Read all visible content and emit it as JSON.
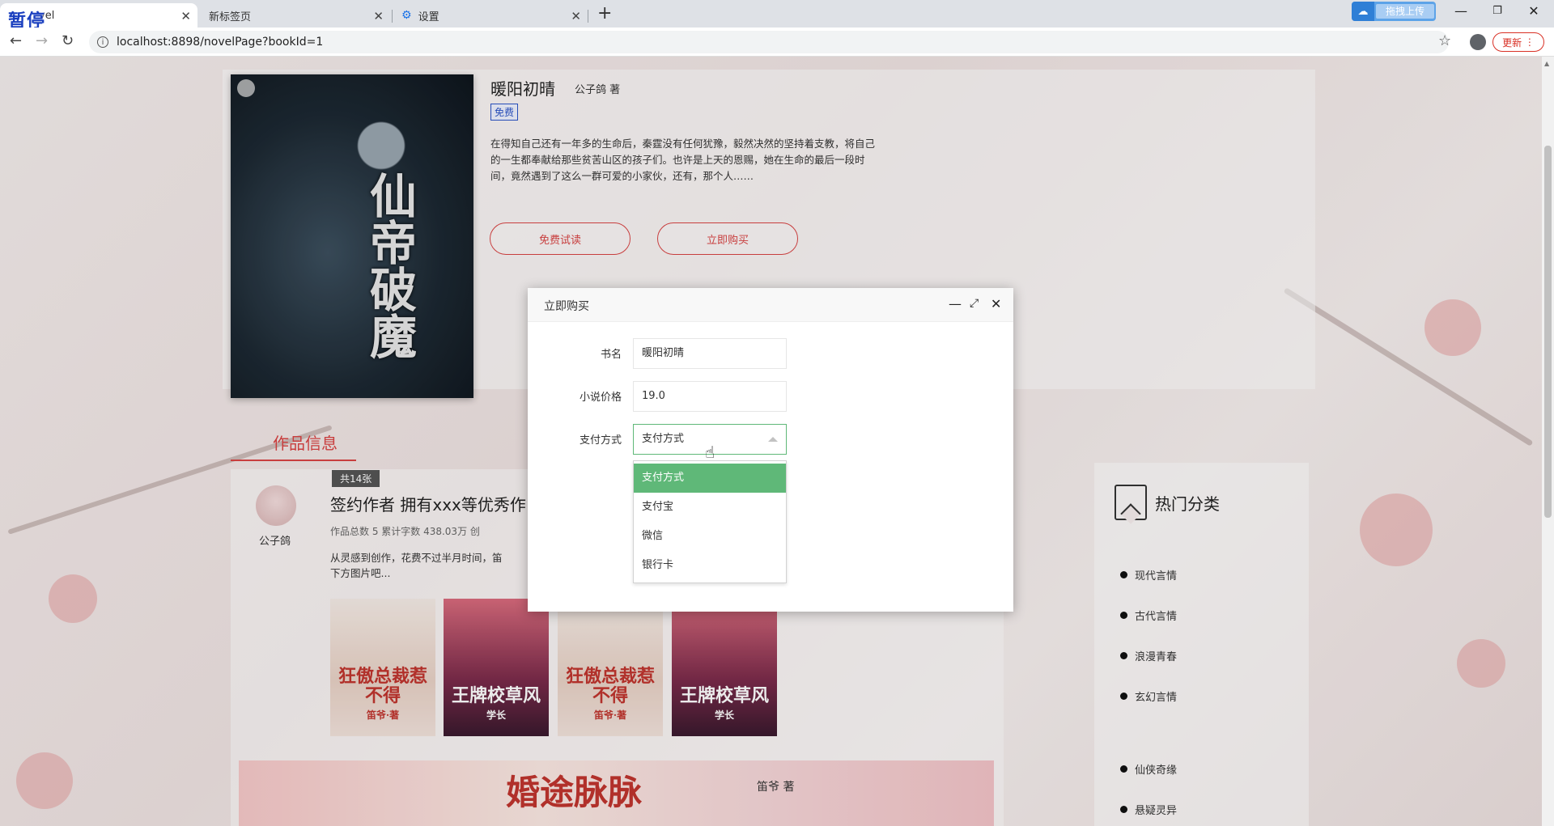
{
  "browser": {
    "tabs": [
      {
        "label": "vel",
        "active": true
      },
      {
        "label": "新标签页",
        "active": false
      },
      {
        "label": "设置",
        "active": false
      }
    ],
    "pause_overlay": "暂停",
    "upload_label": "拖拽上传",
    "url": "localhost:8898/novelPage?bookId=1",
    "update_label": "更新"
  },
  "book": {
    "title": "暖阳初晴",
    "author": "公子鸽 著",
    "badge": "免费",
    "cover_title": "仙帝破魔",
    "description": "在得知自己还有一年多的生命后，秦霆没有任何犹豫，毅然决然的坚持着支教，将自己的一生都奉献给那些贫苦山区的孩子们。也许是上天的恩赐，她在生命的最后一段时间，竟然遇到了这么一群可爱的小家伙，还有，那个人……",
    "free_read_label": "免费试读",
    "buy_label": "立即购买"
  },
  "works": {
    "tab_label": "作品信息",
    "count_tag": "共14张",
    "author_name": "公子鸽",
    "headline": "签约作者 拥有xxx等优秀作",
    "stats": "作品总数 5    累计字数 438.03万    创",
    "description": "从灵感到创作，花费不过半月时间，笛",
    "description2": "下方图片吧...",
    "thumbs": [
      {
        "title": "狂傲总裁惹不得",
        "author": "笛爷·著"
      },
      {
        "title": "王牌校草风",
        "author": "学长"
      },
      {
        "title": "狂傲总裁惹不得",
        "author": "笛爷·著"
      },
      {
        "title": "王牌校草风",
        "author": "学长"
      }
    ],
    "banner_title": "婚途脉脉",
    "banner_author": "笛爷 著"
  },
  "hot": {
    "title": "热门分类",
    "items": [
      "现代言情",
      "古代言情",
      "浪漫青春",
      "玄幻言情",
      "仙侠奇缘",
      "悬疑灵异"
    ]
  },
  "dialog": {
    "title": "立即购买",
    "fields": {
      "book_label": "书名",
      "book_value": "暖阳初晴",
      "price_label": "小说价格",
      "price_value": "19.0",
      "pay_label": "支付方式",
      "pay_value": "支付方式"
    },
    "options": [
      "支付方式",
      "支付宝",
      "微信",
      "银行卡"
    ],
    "selected_option": "支付方式"
  }
}
